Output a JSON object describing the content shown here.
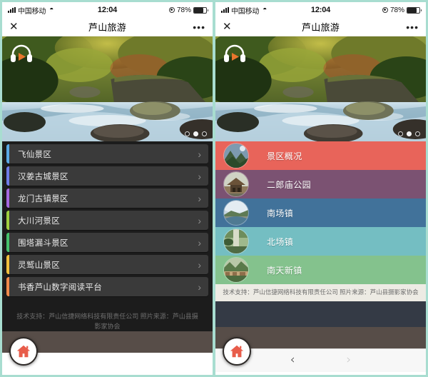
{
  "status_bar": {
    "carrier": "中国移动",
    "signal_icon": "signal-bars-icon",
    "wifi_icon": "wifi-icon",
    "time": "12:04",
    "location_icon": "location-services-icon",
    "battery_percent": "78%",
    "battery_icon": "battery-icon"
  },
  "nav_bar": {
    "close_icon": "✕",
    "title": "芦山旅游",
    "more_icon": "•••"
  },
  "hero": {
    "audio_icon": "headphones-play-icon",
    "dots_total": 3,
    "active_dot_index": 1
  },
  "left_screen": {
    "list": [
      {
        "label": "飞仙景区",
        "accent": "#5aa9e6",
        "chevron": "›"
      },
      {
        "label": "汉姜古城景区",
        "accent": "#6f7ce8",
        "chevron": "›"
      },
      {
        "label": "龙门古镇景区",
        "accent": "#a46ae0",
        "chevron": "›"
      },
      {
        "label": "大川河景区",
        "accent": "#9ed13f",
        "chevron": "›"
      },
      {
        "label": "围塔漏斗景区",
        "accent": "#44c36c",
        "chevron": "›"
      },
      {
        "label": "灵鹫山景区",
        "accent": "#f0c03c",
        "chevron": "›"
      },
      {
        "label": "书香芦山数字阅读平台",
        "accent": "#f08a4b",
        "chevron": "›"
      }
    ],
    "footer": "技术支持：芦山信捷网络科技有限责任公司 照片来源：芦山县摄影家协会",
    "home_icon": "home-icon"
  },
  "right_screen": {
    "list": [
      {
        "label": "景区概况",
        "bg": "#e8645a",
        "thumb": "mountain-photo"
      },
      {
        "label": "二郎庙公园",
        "bg": "#7b5272",
        "thumb": "temple-photo"
      },
      {
        "label": "南场镇",
        "bg": "#41729a",
        "thumb": "bridge-photo"
      },
      {
        "label": "北场镇",
        "bg": "#74bec2",
        "thumb": "field-photo"
      },
      {
        "label": "南天新镇",
        "bg": "#84c28d",
        "thumb": "town-photo"
      }
    ],
    "footer": "技术支持：芦山信捷网络科技有限责任公司 照片来源：芦山县摄影家协会",
    "home_icon": "home-icon",
    "bottom_nav": {
      "back_icon": "‹",
      "forward_icon": "›"
    }
  },
  "colors": {
    "frame": "#a8ddd0",
    "dark_bg": "#1c1c1c",
    "row_bg": "#3a3a3a",
    "brown_bar": "#574d48",
    "home_red": "#e85c4a"
  }
}
